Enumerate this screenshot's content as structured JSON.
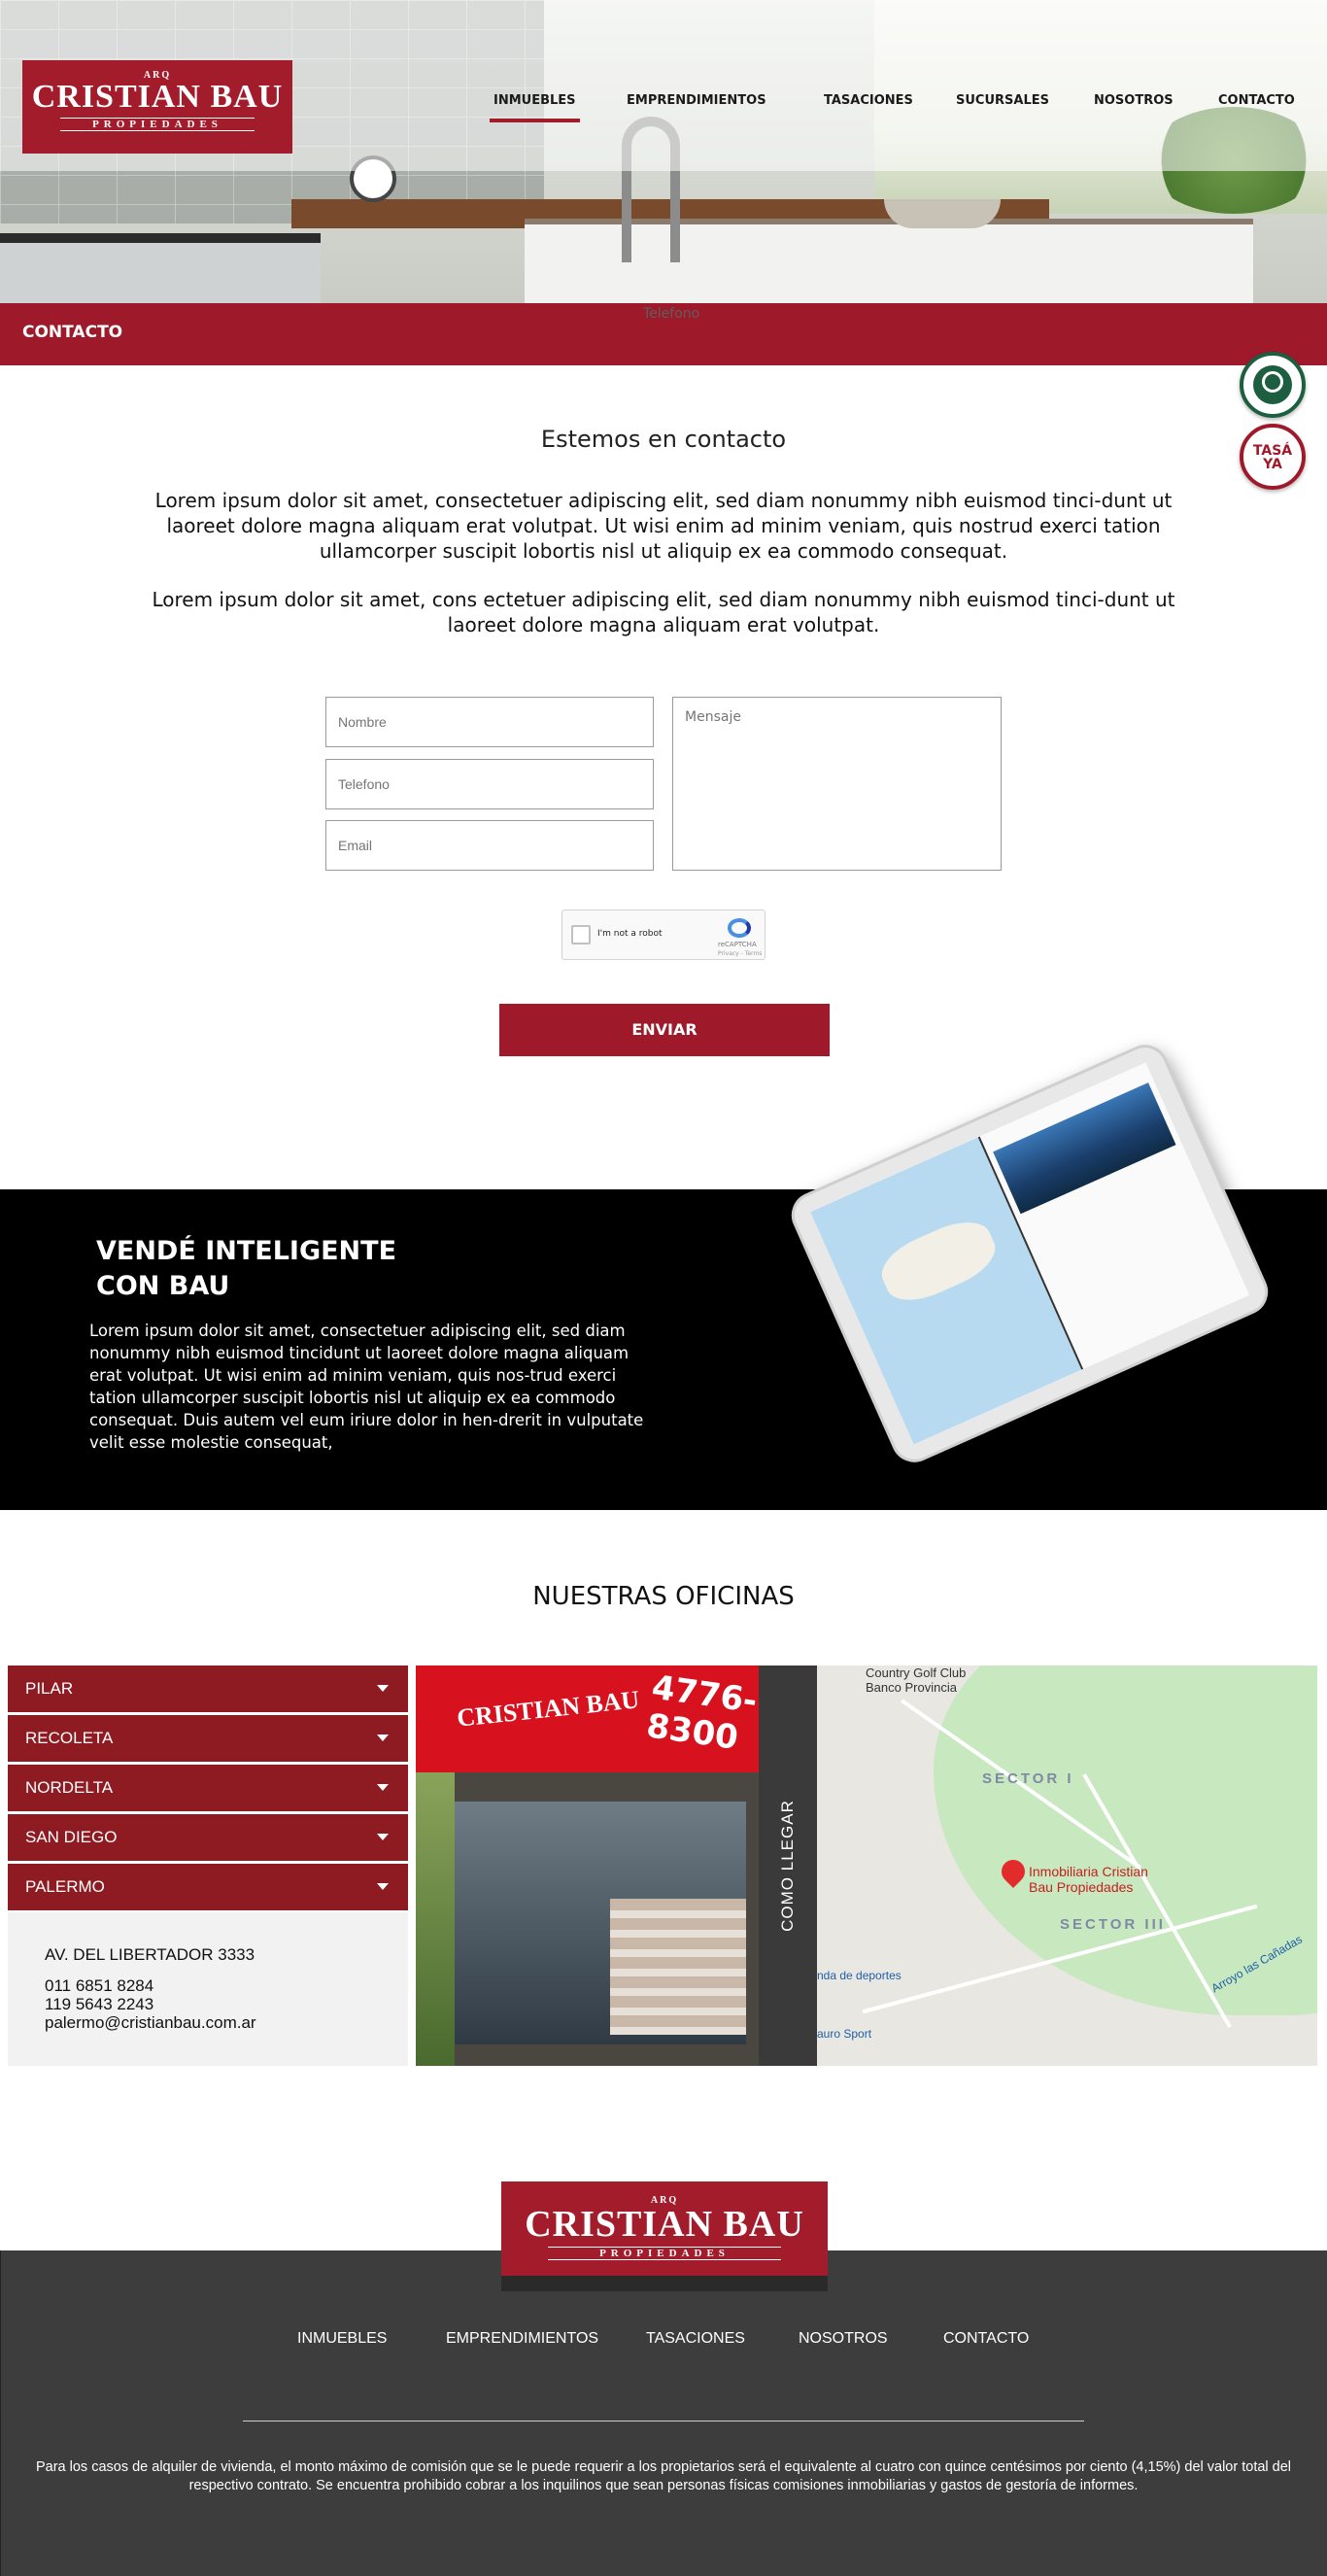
{
  "header": {
    "logo": {
      "arq": "ARQ",
      "name": "CRISTIAN BAU",
      "sub": "PROPIEDADES"
    },
    "nav": [
      "INMUEBLES",
      "EMPRENDIMIENTOS",
      "TASACIONES",
      "SUCURSALES",
      "NOSOTROS",
      "CONTACTO"
    ],
    "active": "INMUEBLES"
  },
  "page_bar": {
    "title": "CONTACTO",
    "ghost_text": "Telefono"
  },
  "floating": {
    "tasa_label_1": "TASÁ",
    "tasa_label_2": "YA"
  },
  "contact": {
    "heading": "Estemos en contacto",
    "paragraph_1": "Lorem ipsum dolor sit amet, consectetuer adipiscing elit, sed diam nonummy nibh euismod tinci-dunt ut laoreet dolore magna aliquam erat volutpat. Ut wisi enim ad minim veniam, quis nostrud exerci tation ullamcorper suscipit lobortis nisl ut aliquip ex ea commodo consequat.",
    "paragraph_2": "Lorem ipsum dolor sit amet, cons ectetuer adipiscing elit, sed diam nonummy nibh euismod tinci-dunt ut laoreet dolore magna aliquam erat volutpat."
  },
  "form": {
    "nombre_placeholder": "Nombre",
    "telefono_placeholder": "Telefono",
    "email_placeholder": "Email",
    "mensaje_placeholder": "Mensaje",
    "captcha_label": "I'm not a robot",
    "captcha_brand": "reCAPTCHA",
    "captcha_links": "Privacy - Terms",
    "submit": "ENVIAR"
  },
  "promo": {
    "heading_1": "VENDÉ INTELIGENTE",
    "heading_2": "CON BAU",
    "body": "Lorem ipsum dolor sit amet, consectetuer adipiscing elit, sed diam nonummy nibh euismod tincidunt ut laoreet dolore magna aliquam erat volutpat. Ut wisi enim ad minim veniam, quis nos-trud exerci tation ullamcorper suscipit lobortis nisl ut aliquip ex ea commodo consequat. Duis autem vel eum iriure dolor in hen-drerit in vulputate velit esse molestie consequat,"
  },
  "offices": {
    "heading": "NUESTRAS OFICINAS",
    "branches": [
      "PILAR",
      "RECOLETA",
      "NORDELTA",
      "SAN DIEGO",
      "PALERMO"
    ],
    "selected": {
      "address": "AV. DEL LIBERTADOR 3333",
      "phone_1": "011 6851  8284",
      "phone_2": "119 5643  2243",
      "email": "palermo@cristianbau.com.ar"
    },
    "storefront": {
      "sign_name": "CRISTIAN BAU",
      "sign_phone": "4776-8300"
    },
    "directions_label": "COMO LLEGAR",
    "map": {
      "place_1": "Inmobiliaria Cristian",
      "place_2": "Bau Propiedades",
      "sector_1": "SECTOR I",
      "sector_3": "SECTOR III",
      "top_label_1": "Country Golf Club",
      "top_label_2": "Banco Provincia",
      "sport_1": "nda de deportes",
      "sport_2": "auro Sport",
      "stream": "Arroyo las Cañadas"
    }
  },
  "footer": {
    "nav": [
      "INMUEBLES",
      "EMPRENDIMIENTOS",
      "TASACIONES",
      "NOSOTROS",
      "CONTACTO"
    ],
    "legal": "Para los casos de alquiler de vivienda, el monto máximo de comisión que se le puede requerir a los propietarios será el equivalente al cuatro con quince centésimos por ciento (4,15%) del valor total del respectivo contrato. Se encuentra prohibido cobrar a los inquilinos que sean personas físicas comisiones inmobiliarias y gastos de gestoría de informes."
  },
  "colors": {
    "brand_red": "#9e1a2b",
    "dark": "#3d3d3d",
    "whatsapp_green": "#1c5e3f"
  }
}
